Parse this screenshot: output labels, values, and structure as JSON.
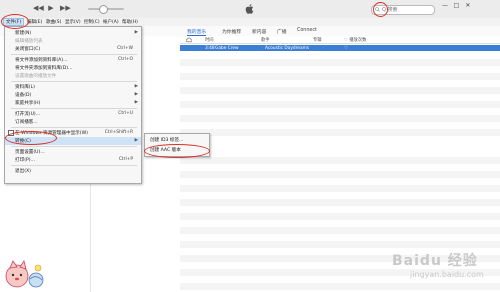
{
  "titlebar": {
    "search_placeholder": "Q 搜索",
    "prev": "◀◀",
    "play": "▶",
    "next": "▶▶",
    "win_min": "—",
    "win_max": "□",
    "win_close": "✕"
  },
  "menubar": {
    "items": [
      "文件(F)",
      "编辑(E)",
      "歌曲(S)",
      "显示(V)",
      "控制(C)",
      "帐户(A)",
      "帮助(H)"
    ]
  },
  "nav": {
    "tabs": [
      "我的音乐",
      "为你推荐",
      "新内容",
      "广播",
      "Connect"
    ]
  },
  "columns": {
    "time": "时间",
    "artist": "歌手",
    "album": "专辑",
    "genre": "类型",
    "plays": "♡ 播放次数"
  },
  "selected_track": {
    "time": "3:48",
    "artist": "Gabe Crew",
    "album": "Acoustic Daydreams",
    "heart": "♡"
  },
  "file_menu": {
    "items": [
      {
        "label": "新建(N)",
        "shortcut": "",
        "arrow": "▶",
        "disabled": false
      },
      {
        "label": "编辑播放列表",
        "shortcut": "",
        "arrow": "",
        "disabled": true
      },
      {
        "label": "关闭窗口(C)",
        "shortcut": "Ctrl+W",
        "arrow": "",
        "disabled": false
      },
      {
        "label": "将文件添加到资料库(A)...",
        "shortcut": "Ctrl+O",
        "arrow": "",
        "disabled": false
      },
      {
        "label": "将文件夹添加到资料库(D)...",
        "shortcut": "",
        "arrow": "",
        "disabled": false
      },
      {
        "label": "设置歌曲的播放文件",
        "shortcut": "",
        "arrow": "",
        "disabled": true
      },
      {
        "label": "资料库(L)",
        "shortcut": "",
        "arrow": "▶",
        "disabled": false
      },
      {
        "label": "设备(D)",
        "shortcut": "",
        "arrow": "▶",
        "disabled": false
      },
      {
        "label": "家庭共享(H)",
        "shortcut": "",
        "arrow": "▶",
        "disabled": false
      },
      {
        "label": "打开流(U)...",
        "shortcut": "Ctrl+U",
        "arrow": "",
        "disabled": false
      },
      {
        "label": "订阅播客...",
        "shortcut": "",
        "arrow": "",
        "disabled": false
      },
      {
        "label": "在 Windows 资源管理器中显示(W)",
        "shortcut": "Ctrl+Shift+R",
        "arrow": "",
        "disabled": false
      },
      {
        "label": "转换(C)",
        "shortcut": "",
        "arrow": "▶",
        "disabled": false
      },
      {
        "label": "页面设置(U)...",
        "shortcut": "",
        "arrow": "",
        "disabled": false
      },
      {
        "label": "打印(P)...",
        "shortcut": "Ctrl+P",
        "arrow": "",
        "disabled": false
      },
      {
        "label": "退出(X)",
        "shortcut": "",
        "arrow": "",
        "disabled": false
      }
    ]
  },
  "sub_menu": {
    "items": [
      "创建 ID3 标签...",
      "创建 AAC 版本"
    ]
  },
  "watermark": {
    "brand": "Baidu 经验",
    "url": "jingyan.baidu.com"
  },
  "colors": {
    "selection": "#3b7fd4",
    "annotation": "#d9312b",
    "menu_highlight": "#cfe3f7",
    "accent": "#2b6fd1"
  }
}
